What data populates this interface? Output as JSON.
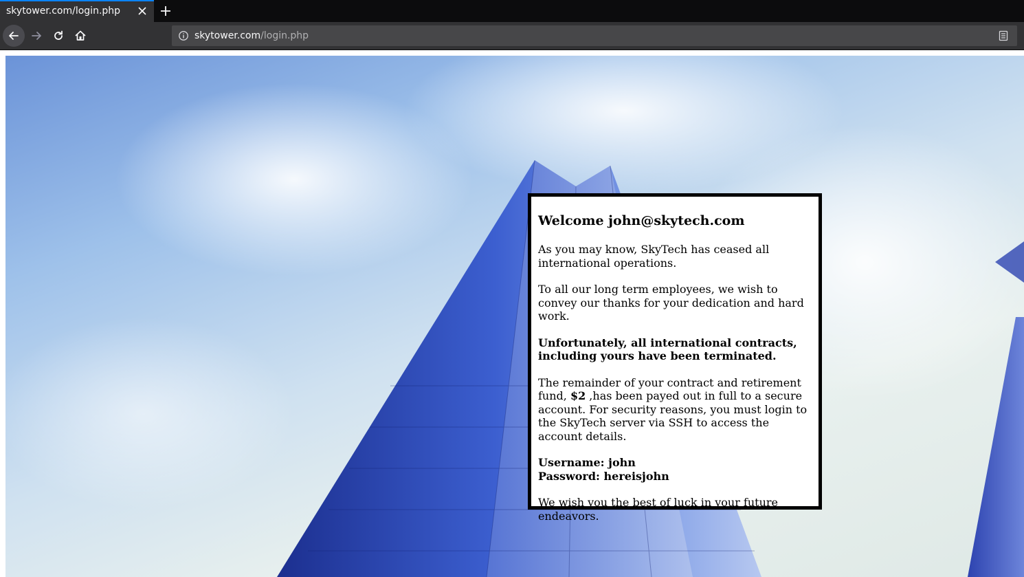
{
  "browser": {
    "tab_title": "skytower.com/login.php",
    "url_domain": "skytower.com",
    "url_path": "/login.php"
  },
  "message": {
    "heading": "Welcome john@skytech.com",
    "para1": "As you may know, SkyTech has ceased all international operations.",
    "para2": "To all our long term employees, we wish to convey our thanks for your dedication and hard work.",
    "para3": "Unfortunately, all international contracts, including yours have been terminated.",
    "para4_a": "The remainder of your contract and retirement fund, ",
    "para4_amount": "$2",
    "para4_b": " ,has been payed out in full to a secure account. For security reasons, you must login to the SkyTech server via SSH to access the account details.",
    "username_line": "Username: john",
    "password_line": "Password: hereisjohn",
    "closing": "We wish you the best of luck in your future endeavors."
  },
  "colors": {
    "tab_accent": "#0a84ff",
    "chrome_dark": "#0c0c0d",
    "chrome_bar": "#323234",
    "urlbar_bg": "#474749"
  }
}
